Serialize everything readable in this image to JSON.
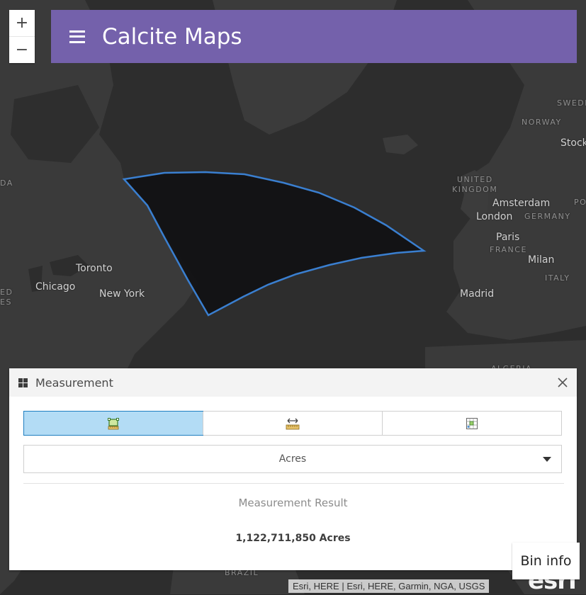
{
  "app": {
    "title": "Calcite Maps"
  },
  "zoom": {
    "in_label": "+",
    "out_label": "−"
  },
  "map": {
    "labels": [
      {
        "text": "SWEDE",
        "kind": "country"
      },
      {
        "text": "NORWAY",
        "kind": "country"
      },
      {
        "text": "Stock",
        "kind": "city"
      },
      {
        "text": "UNITED",
        "kind": "country"
      },
      {
        "text": "KINGDOM",
        "kind": "country"
      },
      {
        "text": "Amsterdam",
        "kind": "city"
      },
      {
        "text": "PO",
        "kind": "country"
      },
      {
        "text": "London",
        "kind": "city"
      },
      {
        "text": "GERMANY",
        "kind": "country"
      },
      {
        "text": "Paris",
        "kind": "city"
      },
      {
        "text": "FRANCE",
        "kind": "country"
      },
      {
        "text": "Milan",
        "kind": "city"
      },
      {
        "text": "ITALY",
        "kind": "country"
      },
      {
        "text": "Madrid",
        "kind": "city"
      },
      {
        "text": "Toronto",
        "kind": "city"
      },
      {
        "text": "Chicago",
        "kind": "city"
      },
      {
        "text": "New York",
        "kind": "city"
      },
      {
        "text": "DA",
        "kind": "country"
      },
      {
        "text": "ED",
        "kind": "country"
      },
      {
        "text": "ES",
        "kind": "country"
      },
      {
        "text": "ALGERIA",
        "kind": "country"
      },
      {
        "text": "BRAZIL",
        "kind": "country"
      }
    ],
    "polygon_fill": "#111114",
    "polygon_stroke": "#3a7fd0"
  },
  "panel": {
    "title": "Measurement",
    "tools": [
      {
        "name": "area-tool",
        "active": true
      },
      {
        "name": "distance-tool",
        "active": false
      },
      {
        "name": "location-tool",
        "active": false
      }
    ],
    "unit": "Acres",
    "result_label": "Measurement Result",
    "result_value": "1,122,711,850 Acres"
  },
  "bin_info": "Bin info",
  "attribution": "Esri, HERE | Esri, HERE, Garmin, NGA, USGS",
  "colors": {
    "header": "#7461ab",
    "active_tool": "#b3dcf5",
    "map_land": "#3a3a3a",
    "map_water": "#2e2e2e"
  }
}
